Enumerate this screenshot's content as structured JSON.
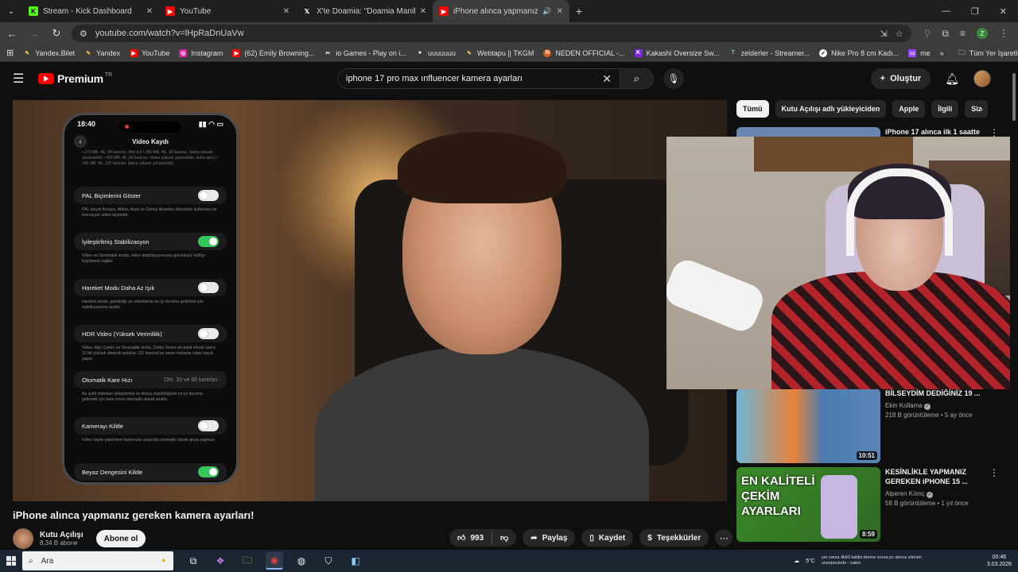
{
  "browser": {
    "tabs": [
      {
        "label": "Stream - Kick Dashboard",
        "icon": "kick-icon",
        "color": "#53fc18"
      },
      {
        "label": "YouTube",
        "icon": "youtube-icon",
        "color": "#ff0000"
      },
      {
        "label": "X'te Doamia: \"Doamia Manifest",
        "icon": "x-icon",
        "color": "#ffffff"
      },
      {
        "label": "iPhone alınca yapmanız gere",
        "icon": "youtube-icon",
        "color": "#ff0000"
      }
    ],
    "url": "youtube.com/watch?v=lHpRaDnUaVw",
    "profile_initial": "Z",
    "bookmarks": [
      {
        "label": "Yandex.Bilet",
        "icon": "pen-icon"
      },
      {
        "label": "Yandex",
        "icon": "yandex-icon"
      },
      {
        "label": "YouTube",
        "icon": "youtube-icon"
      },
      {
        "label": "Instagram",
        "icon": "instagram-icon"
      },
      {
        "label": "(62) Emily Browning...",
        "icon": "youtube-icon"
      },
      {
        "label": "io Games - Play on i...",
        "icon": "games-icon"
      },
      {
        "label": "uuuuuuu",
        "icon": "github-icon"
      },
      {
        "label": "Webtapu || TKGM",
        "icon": "pen-icon"
      },
      {
        "label": "NEDEN OFFICIAL -...",
        "icon": "neden-icon"
      },
      {
        "label": "Kakashi Oversize Sw...",
        "icon": "k-icon"
      },
      {
        "label": "zelderler - Streamer...",
        "icon": "tt-icon"
      },
      {
        "label": "Nike Pro 8 cm Kadı...",
        "icon": "nike-icon"
      },
      {
        "label": "me",
        "icon": "twitch-icon"
      }
    ],
    "all_bookmarks": "Tüm Yer İşaretleri"
  },
  "youtube": {
    "brand": "Premium",
    "region": "TR",
    "search_query": "iphone 17 pro max ınfluencer kamera ayarları",
    "create_label": "Oluştur"
  },
  "phone": {
    "time": "18:40",
    "screen_title": "Video Kaydı",
    "top_note": "• 270 MB, 4K, 24 kare/sn. (film içi) • 350 MB, 4K, 30 kare/sn. (daha yüksek çözünürlük) • 400 MB, 4K, 60 kare/sn. (daha yüksek çözünürlük, daha akıcı) • 740 MB, 4K, 120 kare/sn. (daha yüksek çözünürlük)",
    "settings": [
      {
        "label": "PAL Biçimlerini Göster",
        "on": false,
        "note": "PAL birçok Avrupa, Afrika, Asya ve Güney Amerika ülkesinde kullanılan bir televizyon video biçimidir."
      },
      {
        "label": "İyileştirilmiş Stabilizasyon",
        "on": true,
        "note": "Video ve Sinematik modu, video stabilizasyonunu görüntüyü hafifçe büyüterek sağlar."
      },
      {
        "label": "Hareket Modu Daha Az Işık",
        "on": false,
        "note": "Hareket modu, parlaklığı az ortamlarda en iyi duruma getirmek için stabilizasyonu azaltır."
      },
      {
        "label": "HDR Video (Yüksek Verimlilik)",
        "on": false,
        "note": "Video, Ağır Çekim ve Sinematik modu, Dolby Vision da dahil olmak üzere 10 bit yüksek dinamik aralıkta 120 kare/sn'ye varan hızlarda video kaydı yapar."
      },
      {
        "label": "Otomatik Kare Hızı",
        "value": "Oto. 30 ve 60 kare/sn.",
        "note": "Az ışıklı videoları iyileştirmek ve dosya büyüklüğünü en iyi duruma getirmek için kare hızını otomatik olarak azaltır."
      },
      {
        "label": "Kamerayı Kilitle",
        "on": false,
        "note": "Video kaydı yapılırken kameralar arasında otomatik olarak geçiş yapmaz."
      },
      {
        "label": "Beyaz Dengesini Kilitle",
        "on": true,
        "note": ""
      }
    ]
  },
  "video": {
    "title": "iPhone alınca yapmanız gereken kamera ayarları!",
    "channel": "Kutu Açılışı",
    "subscribers": "8,34 B abone",
    "subscribe_label": "Abone ol",
    "likes": "993",
    "share_label": "Paylaş",
    "save_label": "Kaydet",
    "thanks_label": "Teşekkürler"
  },
  "chips": [
    "Tümü",
    "Kutu Açılışı adlı yükleyiciden",
    "Apple",
    "İlgili",
    "Siz"
  ],
  "recommendations": [
    {
      "title": "iPhone 17 alınca ilk 1 saatte",
      "channel": "",
      "meta": "",
      "duration": "",
      "thumb_color": "#6a86b0"
    },
    {
      "title": "BİLSEYDİM DEDİĞİNİZ 19 ...",
      "channel": "Ekin Kollama",
      "meta": "218 B görüntüleme • 5 ay önce",
      "duration": "10:51",
      "thumb_color": "#6fb4d6"
    },
    {
      "title": "KESİNLİKLE YAPMANIZ GEREKEN iPHONE 15 ...",
      "channel": "Alperen Kılınç",
      "meta": "58 B görüntüleme • 1 yıl önce",
      "duration": "8:59",
      "thumb_color": "#3a8a2a",
      "thumb_text": "EN KALİTELİ ÇEKİM AYARLARI"
    }
  ],
  "taskbar": {
    "search_placeholder": "Ara",
    "weather": "5°C",
    "chat_line1": "yer varsa 4k60 kalitin benne sonra pc alınca silersin",
    "chat_line2": "unexpectede : zaten",
    "time": "00:46",
    "date": "3.03.2026"
  }
}
